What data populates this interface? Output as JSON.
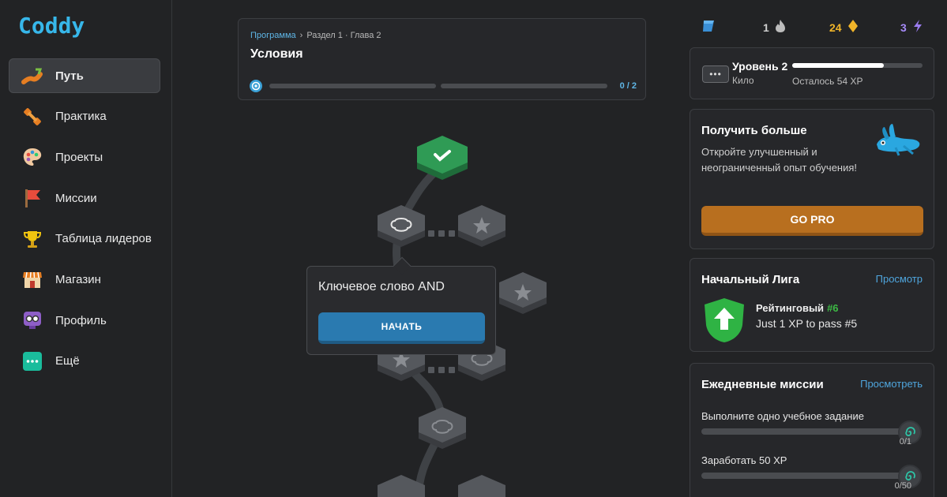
{
  "app": {
    "logo": "Coddy"
  },
  "sidebar": {
    "items": [
      {
        "label": "Путь",
        "icon": "path-icon",
        "active": true
      },
      {
        "label": "Практика",
        "icon": "dumbbell-icon",
        "active": false
      },
      {
        "label": "Проекты",
        "icon": "palette-icon",
        "active": false
      },
      {
        "label": "Миссии",
        "icon": "flag-icon",
        "active": false
      },
      {
        "label": "Таблица лидеров",
        "icon": "trophy-icon",
        "active": false
      },
      {
        "label": "Магазин",
        "icon": "shop-icon",
        "active": false
      },
      {
        "label": "Профиль",
        "icon": "avatar-icon",
        "active": false
      },
      {
        "label": "Ещё",
        "icon": "more-icon",
        "active": false
      }
    ]
  },
  "course": {
    "breadcrumb_program": "Программа",
    "breadcrumb_separator": "›",
    "breadcrumb_section": "Раздел 1 · Глава 2",
    "title": "Условия",
    "progress_count": "0 / 2",
    "progress_fraction": 0
  },
  "lesson_popup": {
    "title": "Ключевое слово AND",
    "start_label": "НАЧАТЬ"
  },
  "stats": {
    "gems_icon": "blue-gem-icon",
    "streak": "1",
    "coins": "24",
    "energy": "3",
    "colors": {
      "coins": "#f0b429",
      "energy": "#a78bfa",
      "streak": "#cfcfcf"
    }
  },
  "level": {
    "badge": "•••",
    "title": "Уровень 2",
    "subtitle": "Кило",
    "remaining": "Осталось 54 XP",
    "progress_fraction": 0.7
  },
  "pro": {
    "title": "Получить больше",
    "text": "Откройте улучшенный и неограниченный опыт обучения!",
    "button": "GO PRO"
  },
  "league": {
    "title": "Начальный Лига",
    "link": "Просмотр",
    "name": "Рейтинговый",
    "rank": "#6",
    "subtitle": "Just 1 XP to pass #5"
  },
  "missions": {
    "title": "Ежедневные миссии",
    "link": "Просмотреть",
    "items": [
      {
        "label": "Выполните одно учебное задание",
        "count": "0/1",
        "progress_fraction": 0
      },
      {
        "label": "Заработать 50 XP",
        "count": "0/50",
        "progress_fraction": 0
      }
    ]
  },
  "colors": {
    "accent": "#37b7ea",
    "pro_button": "#b86f1f",
    "start_button": "#2a7ab0",
    "success": "#3dbb45"
  }
}
